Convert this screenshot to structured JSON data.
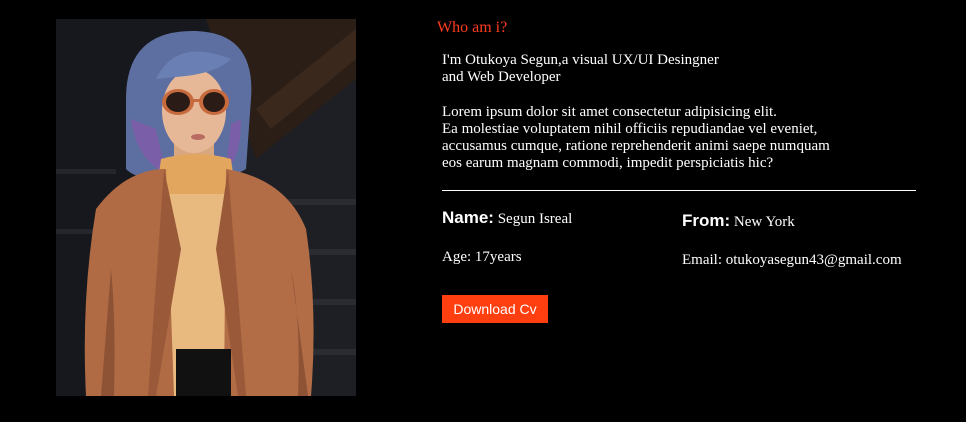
{
  "about": {
    "heading": "Who am i?",
    "intro_line1": "I'm Otukoya Segun,a visual UX/UI Desingner",
    "intro_line2": "and Web Developer",
    "lorem_line1": "Lorem ipsum dolor sit amet consectetur adipisicing elit.",
    "lorem_line2": "Ea molestiae voluptatem nihil officiis repudiandae vel eveniet,",
    "lorem_line3": "accusamus cumque, ratione reprehenderit animi saepe numquam",
    "lorem_line4": "eos earum magnam commodi, impedit perspiciatis hic?"
  },
  "details": {
    "name_key": "Name:",
    "name_value": "Segun Isreal",
    "from_key": "From:",
    "from_value": "New York",
    "age_text": "Age: 17years",
    "email_text": "Email: otukoyasegun43@gmail.com"
  },
  "actions": {
    "download_label": "Download Cv"
  },
  "colors": {
    "accent": "#ff3f0f",
    "heading": "#ff3b1f",
    "background": "#000000",
    "text": "#ffffff"
  }
}
